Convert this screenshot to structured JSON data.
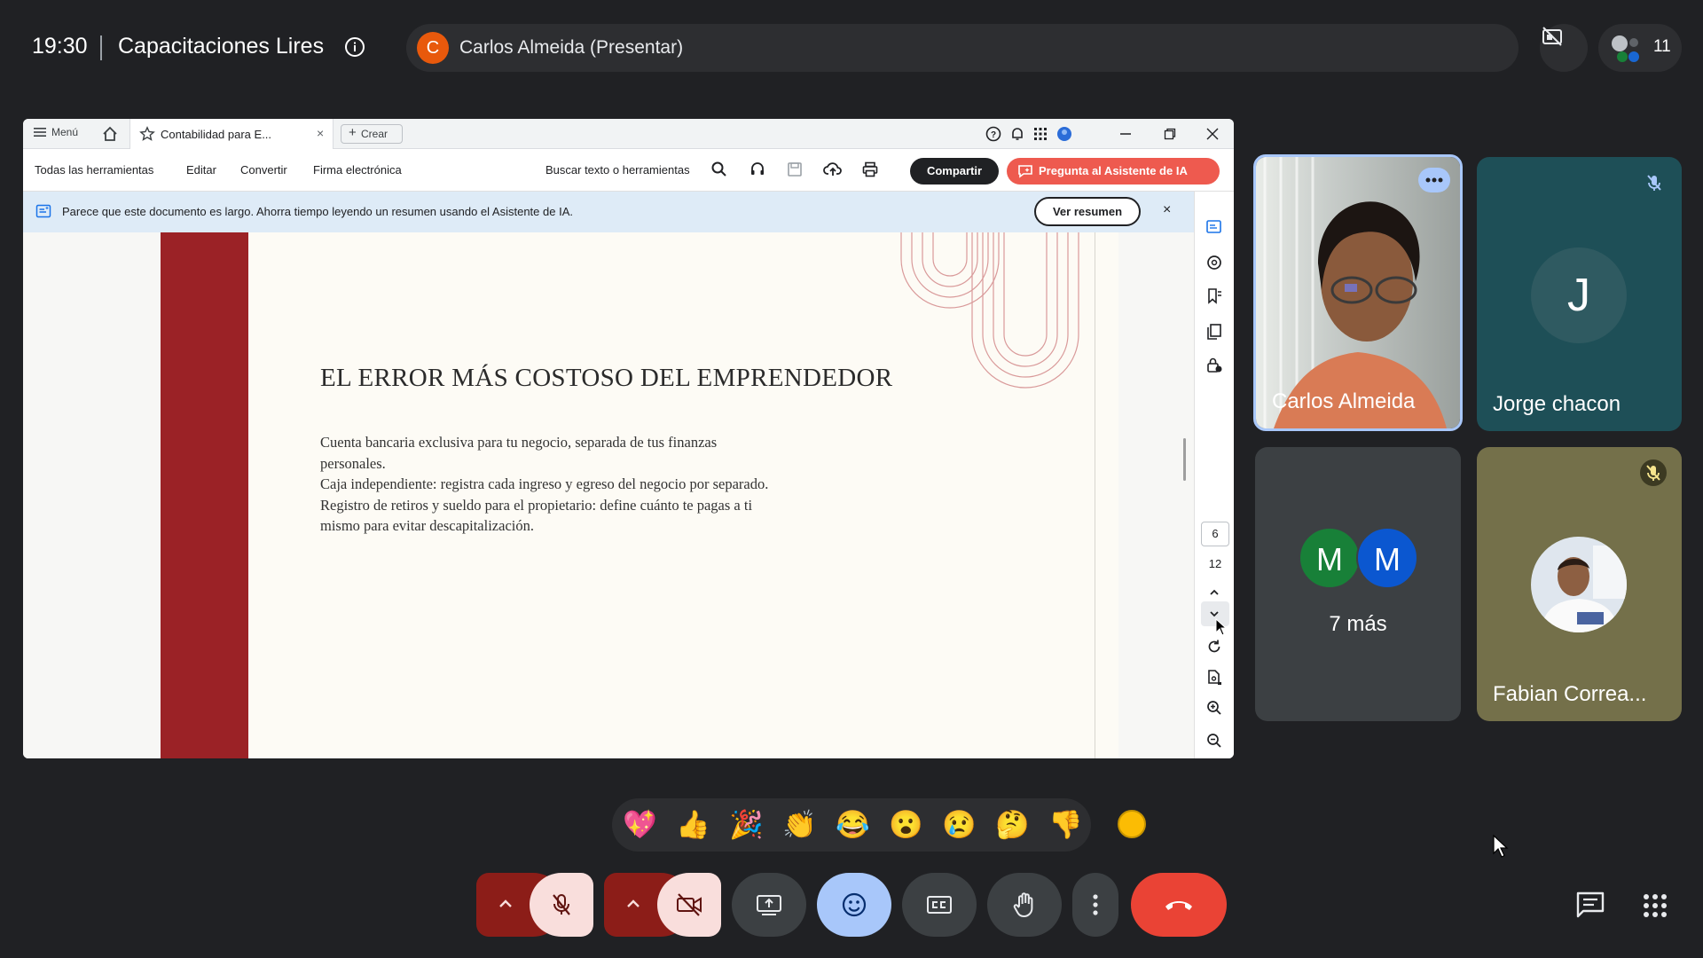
{
  "meeting": {
    "time": "19:30",
    "title": "Capacitaciones Lires",
    "presenter_initial": "C",
    "presenter_label": "Carlos Almeida (Presentar)",
    "participant_count": "11"
  },
  "acrobat": {
    "menu_label": "Menú",
    "tab_label": "Contabilidad para E...",
    "tab_close": "×",
    "create_label": "Crear",
    "toolbar": {
      "all_tools": "Todas las herramientas",
      "edit": "Editar",
      "convert": "Convertir",
      "esign": "Firma electrónica",
      "search": "Buscar texto o herramientas",
      "share": "Compartir",
      "ai_assistant": "Pregunta al Asistente de IA"
    },
    "banner": {
      "text": "Parece que este documento es largo. Ahorra tiempo leyendo un resumen usando el Asistente de IA.",
      "button": "Ver resumen",
      "close": "×"
    },
    "page": {
      "current": "6",
      "total": "12"
    },
    "document": {
      "heading": "EL ERROR MÁS COSTOSO DEL EMPRENDEDOR",
      "lines": [
        "Cuenta bancaria exclusiva para tu negocio, separada de tus finanzas",
        "personales.",
        "Caja independiente: registra cada ingreso y egreso del negocio por separado.",
        "Registro de retiros y sueldo para el propietario: define cuánto te pagas a ti",
        "mismo para evitar descapitalización."
      ],
      "accent_color": "#9b2226"
    }
  },
  "tiles": {
    "carlos": {
      "name": "Carlos Almeida"
    },
    "jorge": {
      "name": "Jorge chacon",
      "initial": "J"
    },
    "more": {
      "avatar1": "M",
      "avatar2": "M",
      "label": "7 más"
    },
    "fabian": {
      "name": "Fabian Correa..."
    }
  },
  "reactions": [
    "💖",
    "👍",
    "🎉",
    "👏",
    "😂",
    "😮",
    "😢",
    "🤔",
    "👎"
  ],
  "colors": {
    "background": "#202124",
    "end_call": "#ea4335",
    "reaction_active": "#a8c7fa",
    "muted_red": "#8c1d18"
  }
}
